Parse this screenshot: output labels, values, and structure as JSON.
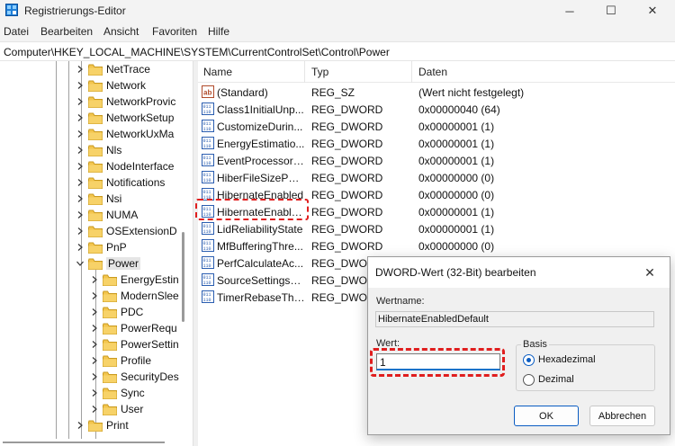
{
  "window": {
    "title": "Registrierungs-Editor",
    "min_glyph": "─",
    "max_glyph": "☐",
    "close_glyph": "✕"
  },
  "menu": [
    "Datei",
    "Bearbeiten",
    "Ansicht",
    "Favoriten",
    "Hilfe"
  ],
  "address": "Computer\\HKEY_LOCAL_MACHINE\\SYSTEM\\CurrentControlSet\\Control\\Power",
  "tree": {
    "items": [
      {
        "label": "NetTrace",
        "level": 0,
        "expanded": false
      },
      {
        "label": "Network",
        "level": 0,
        "expanded": false
      },
      {
        "label": "NetworkProvic",
        "level": 0,
        "expanded": false
      },
      {
        "label": "NetworkSetup",
        "level": 0,
        "expanded": false
      },
      {
        "label": "NetworkUxMa",
        "level": 0,
        "expanded": false
      },
      {
        "label": "Nls",
        "level": 0,
        "expanded": false
      },
      {
        "label": "NodeInterface",
        "level": 0,
        "expanded": false
      },
      {
        "label": "Notifications",
        "level": 0,
        "expanded": false
      },
      {
        "label": "Nsi",
        "level": 0,
        "expanded": false
      },
      {
        "label": "NUMA",
        "level": 0,
        "expanded": false
      },
      {
        "label": "OSExtensionD",
        "level": 0,
        "expanded": false
      },
      {
        "label": "PnP",
        "level": 0,
        "expanded": false
      },
      {
        "label": "Power",
        "level": 0,
        "expanded": true,
        "selected": true
      },
      {
        "label": "EnergyEstin",
        "level": 1,
        "expanded": false
      },
      {
        "label": "ModernSlee",
        "level": 1,
        "expanded": false
      },
      {
        "label": "PDC",
        "level": 1,
        "expanded": false
      },
      {
        "label": "PowerRequ",
        "level": 1,
        "expanded": false
      },
      {
        "label": "PowerSettin",
        "level": 1,
        "expanded": false
      },
      {
        "label": "Profile",
        "level": 1,
        "expanded": false
      },
      {
        "label": "SecurityDes",
        "level": 1,
        "expanded": false
      },
      {
        "label": "Sync",
        "level": 1,
        "expanded": false
      },
      {
        "label": "User",
        "level": 1,
        "expanded": false
      },
      {
        "label": "Print",
        "level": 0,
        "expanded": false
      }
    ]
  },
  "list": {
    "columns": [
      "Name",
      "Typ",
      "Daten"
    ],
    "rows": [
      {
        "icon": "string-value-icon",
        "name": "(Standard)",
        "type": "REG_SZ",
        "data": "(Wert nicht festgelegt)"
      },
      {
        "icon": "binary-value-icon",
        "name": "Class1InitialUnp...",
        "type": "REG_DWORD",
        "data": "0x00000040 (64)"
      },
      {
        "icon": "binary-value-icon",
        "name": "CustomizeDurin...",
        "type": "REG_DWORD",
        "data": "0x00000001 (1)"
      },
      {
        "icon": "binary-value-icon",
        "name": "EnergyEstimatio...",
        "type": "REG_DWORD",
        "data": "0x00000001 (1)"
      },
      {
        "icon": "binary-value-icon",
        "name": "EventProcessorE...",
        "type": "REG_DWORD",
        "data": "0x00000001 (1)"
      },
      {
        "icon": "binary-value-icon",
        "name": "HiberFileSizePer...",
        "type": "REG_DWORD",
        "data": "0x00000000 (0)"
      },
      {
        "icon": "binary-value-icon",
        "name": "HibernateEnabled",
        "type": "REG_DWORD",
        "data": "0x00000000 (0)"
      },
      {
        "icon": "binary-value-icon",
        "name": "HibernateEnable...",
        "type": "REG_DWORD",
        "data": "0x00000001 (1)"
      },
      {
        "icon": "binary-value-icon",
        "name": "LidReliabilityState",
        "type": "REG_DWORD",
        "data": "0x00000001 (1)"
      },
      {
        "icon": "binary-value-icon",
        "name": "MfBufferingThre...",
        "type": "REG_DWORD",
        "data": "0x00000000 (0)"
      },
      {
        "icon": "binary-value-icon",
        "name": "PerfCalculateAc...",
        "type": "REG_DWORD",
        "data": ""
      },
      {
        "icon": "binary-value-icon",
        "name": "SourceSettingsV...",
        "type": "REG_DWORD",
        "data": ""
      },
      {
        "icon": "binary-value-icon",
        "name": "TimerRebaseThr...",
        "type": "REG_DWORD",
        "data": ""
      }
    ]
  },
  "dialog": {
    "title": "DWORD-Wert (32-Bit) bearbeiten",
    "close_glyph": "✕",
    "name_label": "Wertname:",
    "name_value": "HibernateEnabledDefault",
    "value_label": "Wert:",
    "value": "1",
    "basis_label": "Basis",
    "radio_hex": "Hexadezimal",
    "radio_dec": "Dezimal",
    "selected_basis": "Hexadezimal",
    "ok_label": "OK",
    "cancel_label": "Abbrechen"
  },
  "colors": {
    "highlight": "#e01e1e",
    "accent": "#0a5cc2",
    "folder": "#f0c04a"
  }
}
